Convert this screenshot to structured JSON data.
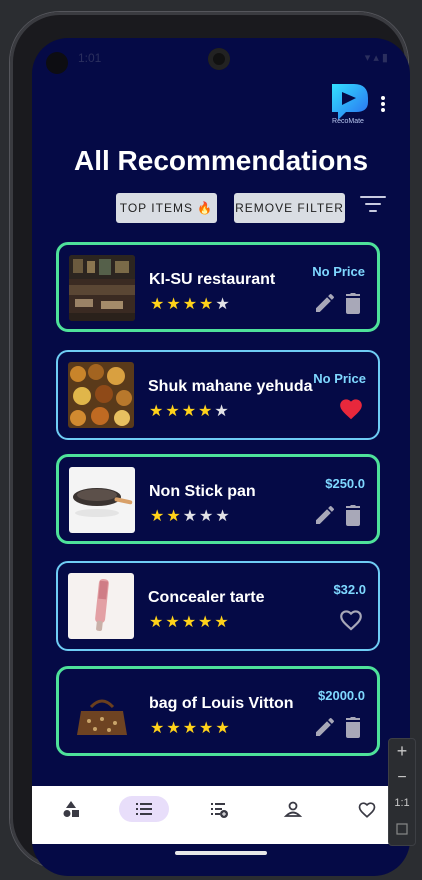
{
  "status_bar": {
    "time": "1:01",
    "right_icons": "▾ ▴ ▮"
  },
  "app": {
    "logo_name": "recomate-logo",
    "logo_text": "RecoMate"
  },
  "page_title": "All Recommendations",
  "filters": {
    "top_items_label": "TOP ITEMS 🔥",
    "remove_filter_label": "REMOVE FILTER"
  },
  "colors": {
    "background": "#050a46",
    "card_border_green": "#4ee29a",
    "card_border_blue": "#6fcdf5",
    "price": "#7fd8ff",
    "star": "#ffd21a",
    "heart": "#e8283c"
  },
  "recommendations": [
    {
      "title": "KI-SU restaurant",
      "rating": 4,
      "price": "No Price",
      "owned": true,
      "liked": false
    },
    {
      "title": "Shuk mahane yehuda",
      "rating": 4,
      "price": "No Price",
      "owned": false,
      "liked": true
    },
    {
      "title": "Non Stick pan",
      "rating": 2,
      "price": "$250.0",
      "owned": true,
      "liked": false
    },
    {
      "title": "Concealer tarte",
      "rating": 5,
      "price": "$32.0",
      "owned": false,
      "liked": false
    },
    {
      "title": "bag of Louis Vitton",
      "rating": 5,
      "price": "$2000.0",
      "owned": true,
      "liked": false
    }
  ],
  "bottom_nav": [
    {
      "icon": "categories-icon",
      "active": false
    },
    {
      "icon": "list-icon",
      "active": true
    },
    {
      "icon": "add-to-list-icon",
      "active": false
    },
    {
      "icon": "profile-icon",
      "active": false
    },
    {
      "icon": "heart-outline-icon",
      "active": false
    }
  ],
  "emulator_controls": {
    "zoom_in": "+",
    "zoom_out": "−",
    "one_to_one": "1:1"
  }
}
